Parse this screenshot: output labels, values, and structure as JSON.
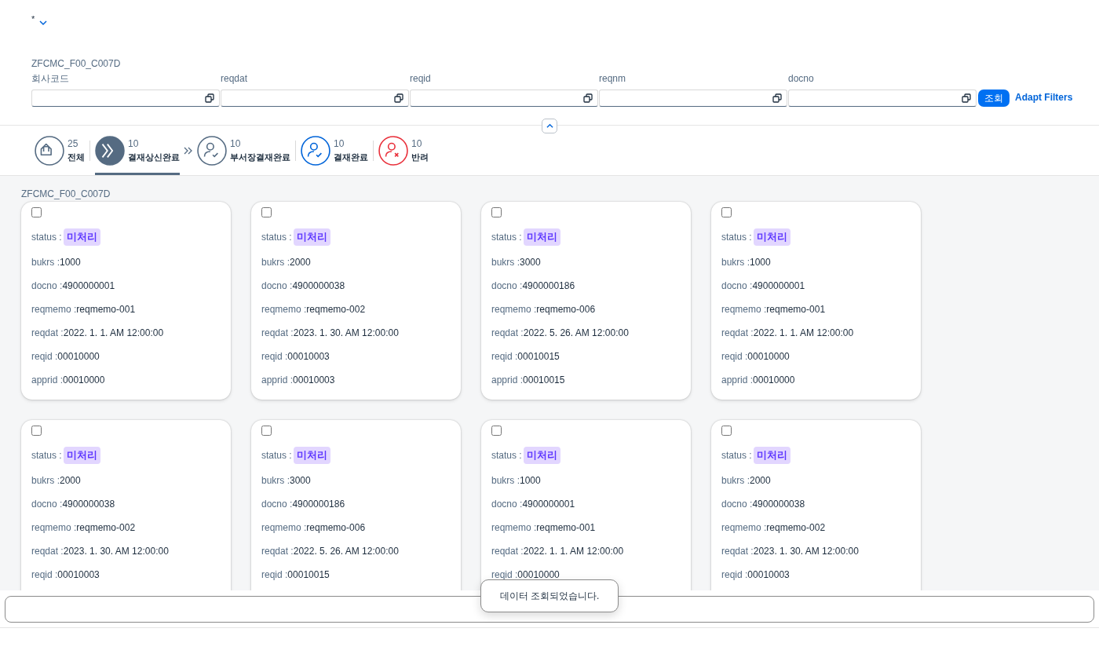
{
  "header": {
    "variant": "*"
  },
  "filter_bar": {
    "title": "ZFCMC_F00_C007D",
    "fields": [
      {
        "label": "회사코드"
      },
      {
        "label": "reqdat"
      },
      {
        "label": "reqid"
      },
      {
        "label": "reqnm"
      },
      {
        "label": "docno"
      }
    ],
    "go_button": "조회",
    "adapt_link": "Adapt Filters"
  },
  "tabs": [
    {
      "count": "25",
      "label": "전체",
      "kind": "home",
      "color": "#556b82",
      "selected": false
    },
    {
      "count": "10",
      "label": "결재상신완료",
      "kind": "forward",
      "color": "#556b82",
      "selected": true
    },
    {
      "count": "10",
      "label": "부서장결재완료",
      "kind": "person-check",
      "color": "#556b82",
      "selected": false
    },
    {
      "count": "10",
      "label": "결재완료",
      "kind": "person-check",
      "color": "#0064d9",
      "selected": false
    },
    {
      "count": "10",
      "label": "반려",
      "kind": "person-x",
      "color": "#e9303b",
      "selected": false
    }
  ],
  "list_title": "ZFCMC_F00_C007D",
  "cards": [
    {
      "checked": false,
      "status_field": "status :",
      "status": "미처리",
      "fields": [
        {
          "label": "bukrs :",
          "value": "1000"
        },
        {
          "label": "docno :",
          "value": "4900000001"
        },
        {
          "label": "reqmemo :",
          "value": "reqmemo-001"
        },
        {
          "label": "reqdat :",
          "value": "2022. 1. 1. AM 12:00:00"
        },
        {
          "label": "reqid :",
          "value": "00010000"
        },
        {
          "label": "apprid :",
          "value": "00010000"
        }
      ]
    },
    {
      "checked": false,
      "status_field": "status :",
      "status": "미처리",
      "fields": [
        {
          "label": "bukrs :",
          "value": "2000"
        },
        {
          "label": "docno :",
          "value": "4900000038"
        },
        {
          "label": "reqmemo :",
          "value": "reqmemo-002"
        },
        {
          "label": "reqdat :",
          "value": "2023. 1. 30. AM 12:00:00"
        },
        {
          "label": "reqid :",
          "value": "00010003"
        },
        {
          "label": "apprid :",
          "value": "00010003"
        }
      ]
    },
    {
      "checked": false,
      "status_field": "status :",
      "status": "미처리",
      "fields": [
        {
          "label": "bukrs :",
          "value": "3000"
        },
        {
          "label": "docno :",
          "value": "4900000186"
        },
        {
          "label": "reqmemo :",
          "value": "reqmemo-006"
        },
        {
          "label": "reqdat :",
          "value": "2022. 5. 26. AM 12:00:00"
        },
        {
          "label": "reqid :",
          "value": "00010015"
        },
        {
          "label": "apprid :",
          "value": "00010015"
        }
      ]
    },
    {
      "checked": false,
      "status_field": "status :",
      "status": "미처리",
      "fields": [
        {
          "label": "bukrs :",
          "value": "1000"
        },
        {
          "label": "docno :",
          "value": "4900000001"
        },
        {
          "label": "reqmemo :",
          "value": "reqmemo-001"
        },
        {
          "label": "reqdat :",
          "value": "2022. 1. 1. AM 12:00:00"
        },
        {
          "label": "reqid :",
          "value": "00010000"
        },
        {
          "label": "apprid :",
          "value": "00010000"
        }
      ]
    },
    {
      "checked": false,
      "status_field": "status :",
      "status": "미처리",
      "fields": [
        {
          "label": "bukrs :",
          "value": "2000"
        },
        {
          "label": "docno :",
          "value": "4900000038"
        },
        {
          "label": "reqmemo :",
          "value": "reqmemo-002"
        },
        {
          "label": "reqdat :",
          "value": "2023. 1. 30. AM 12:00:00"
        },
        {
          "label": "reqid :",
          "value": "00010003"
        }
      ]
    },
    {
      "checked": false,
      "status_field": "status :",
      "status": "미처리",
      "fields": [
        {
          "label": "bukrs :",
          "value": "3000"
        },
        {
          "label": "docno :",
          "value": "4900000186"
        },
        {
          "label": "reqmemo :",
          "value": "reqmemo-006"
        },
        {
          "label": "reqdat :",
          "value": "2022. 5. 26. AM 12:00:00"
        },
        {
          "label": "reqid :",
          "value": "00010015"
        }
      ]
    },
    {
      "checked": false,
      "status_field": "status :",
      "status": "미처리",
      "fields": [
        {
          "label": "bukrs :",
          "value": "1000"
        },
        {
          "label": "docno :",
          "value": "4900000001"
        },
        {
          "label": "reqmemo :",
          "value": "reqmemo-001"
        },
        {
          "label": "reqdat :",
          "value": "2022. 1. 1. AM 12:00:00"
        },
        {
          "label": "reqid :",
          "value": "00010000"
        }
      ]
    },
    {
      "checked": false,
      "status_field": "status :",
      "status": "미처리",
      "fields": [
        {
          "label": "bukrs :",
          "value": "2000"
        },
        {
          "label": "docno :",
          "value": "4900000038"
        },
        {
          "label": "reqmemo :",
          "value": "reqmemo-002"
        },
        {
          "label": "reqdat :",
          "value": "2023. 1. 30. AM 12:00:00"
        },
        {
          "label": "reqid :",
          "value": "00010003"
        }
      ]
    }
  ],
  "toast": "데이터 조회되었습니다."
}
